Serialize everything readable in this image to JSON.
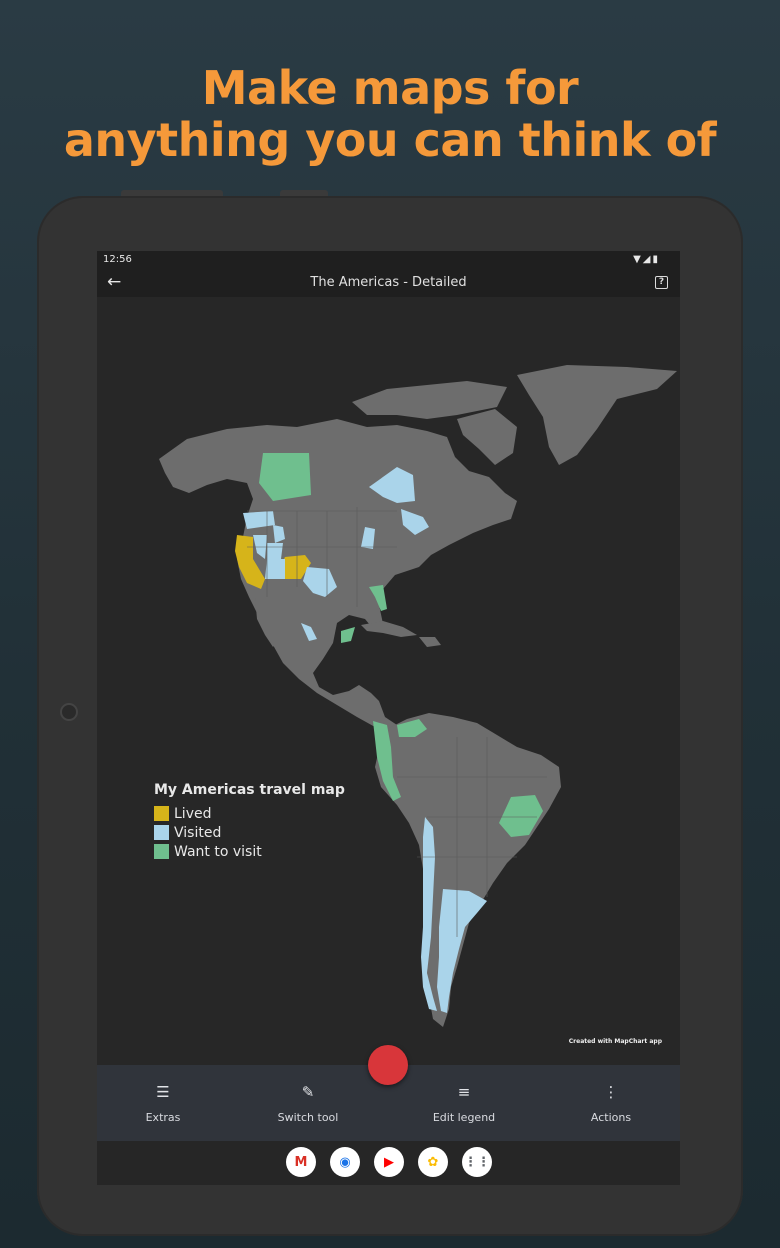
{
  "headline": {
    "line1": "Make maps for",
    "line2": "anything you can think of"
  },
  "status_bar": {
    "time": "12:56",
    "icons": [
      "wifi-icon",
      "signal-icon",
      "battery-icon"
    ]
  },
  "app_bar": {
    "title": "The Americas - Detailed",
    "back_icon": "arrow-left-icon",
    "help_icon": "help-box-icon"
  },
  "map": {
    "legend": {
      "title": "My Americas travel map",
      "items": [
        {
          "label": "Lived",
          "color": "#d6b41a"
        },
        {
          "label": "Visited",
          "color": "#aad4ea"
        },
        {
          "label": "Want to visit",
          "color": "#6fbf8e"
        }
      ]
    },
    "credit": "Created with MapChart app",
    "base_color": "#6d6d6d",
    "background_color": "#272727"
  },
  "fab": {
    "color": "#d8363a"
  },
  "toolbar": {
    "items": [
      {
        "label": "Extras",
        "icon": "tune-icon"
      },
      {
        "label": "Switch tool",
        "icon": "brush-icon"
      },
      {
        "label": "Edit legend",
        "icon": "list-icon"
      },
      {
        "label": "Actions",
        "icon": "more-vertical-icon"
      }
    ]
  },
  "nav_dock": {
    "apps": [
      {
        "icon": "gmail-icon",
        "glyph": "M",
        "color": "#d93025"
      },
      {
        "icon": "chrome-icon",
        "glyph": "◉",
        "color": "#1a73e8"
      },
      {
        "icon": "youtube-icon",
        "glyph": "▶",
        "color": "#ff0000"
      },
      {
        "icon": "photos-icon",
        "glyph": "✿",
        "color": "#fbbc04"
      },
      {
        "icon": "app-drawer-icon",
        "glyph": "⋮⋮",
        "color": "#5f6368"
      }
    ]
  }
}
